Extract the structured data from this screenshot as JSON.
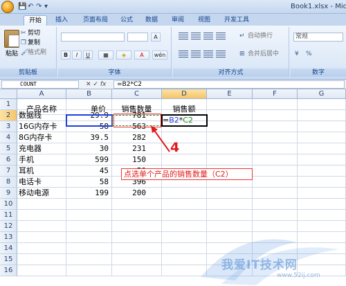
{
  "window": {
    "title": "Book1.xlsx - Mic"
  },
  "quick_access": {
    "undo": "↶",
    "redo": "↷",
    "customize": "▾"
  },
  "tabs": [
    {
      "label": "开始",
      "active": true
    },
    {
      "label": "插入"
    },
    {
      "label": "页面布局"
    },
    {
      "label": "公式"
    },
    {
      "label": "数据"
    },
    {
      "label": "审阅"
    },
    {
      "label": "视图"
    },
    {
      "label": "开发工具"
    }
  ],
  "ribbon": {
    "clipboard": {
      "label": "剪贴板",
      "paste": "粘贴",
      "cut": "剪切",
      "copy": "复制",
      "format_painter": "格式刷"
    },
    "font": {
      "label": "字体",
      "bold": "B",
      "italic": "I",
      "underline": "U",
      "font_color": "A",
      "phonetic": "wén"
    },
    "alignment": {
      "label": "对齐方式",
      "wrap": "自动换行",
      "merge": "合并后居中"
    },
    "number": {
      "label": "数字",
      "format": "常规"
    }
  },
  "formula_bar": {
    "name_box": "COUNT",
    "cancel": "✕",
    "enter": "✓",
    "fx": "fx",
    "formula": "=B2*C2"
  },
  "columns": [
    "A",
    "B",
    "C",
    "D",
    "E",
    "F",
    "G"
  ],
  "rows": [
    "1",
    "2",
    "3",
    "4",
    "5",
    "6",
    "7",
    "8",
    "9",
    "10",
    "11",
    "12",
    "13",
    "14",
    "15",
    "16"
  ],
  "table": {
    "headers": [
      "产品名称",
      "单价",
      "销售数量",
      "销售额"
    ],
    "data": [
      [
        "数据线",
        "29.9",
        "781",
        "=B2*C2"
      ],
      [
        "16G内存卡",
        "58",
        "563",
        ""
      ],
      [
        "8G内存卡",
        "39.5",
        "282",
        ""
      ],
      [
        "充电器",
        "30",
        "231",
        ""
      ],
      [
        "手机",
        "599",
        "150",
        ""
      ],
      [
        "耳机",
        "45",
        "50",
        ""
      ],
      [
        "电话卡",
        "58",
        "396",
        ""
      ],
      [
        "移动电源",
        "199",
        "200",
        ""
      ]
    ],
    "formula_parts": {
      "eq": "=",
      "ref1": "B2",
      "op": "*",
      "ref2": "C2"
    }
  },
  "annotation": {
    "step_number": "4",
    "callout_text": "点选单个产品的销售数量（C2）"
  },
  "watermark": {
    "text": "我爱IT技术网",
    "url": "www.52ij.com"
  },
  "colors": {
    "ref_b": "#1f3fd8",
    "ref_c": "#1b8a1b",
    "annotation": "#e01b1b"
  }
}
